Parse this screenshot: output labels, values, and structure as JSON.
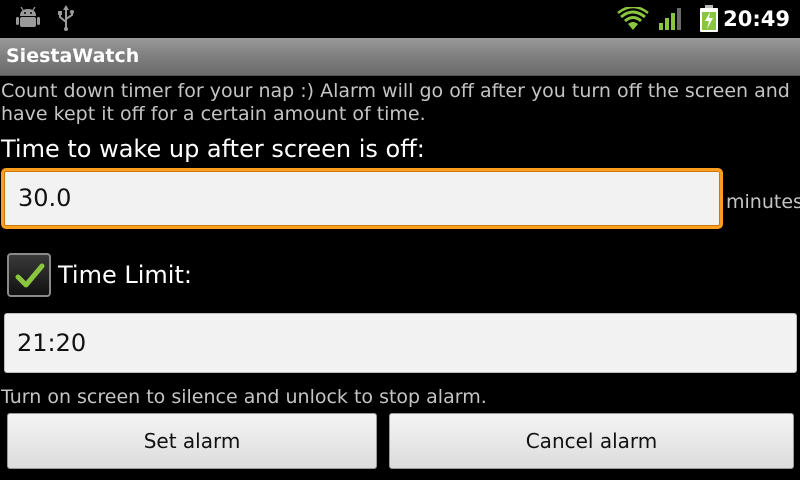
{
  "status_bar": {
    "time": "20:49",
    "icons": [
      "android-debug-icon",
      "usb-icon",
      "wifi-icon",
      "signal-icon",
      "battery-charging-icon"
    ],
    "accent_color": "#8ac53f"
  },
  "app": {
    "title": "SiestaWatch"
  },
  "main": {
    "description": "Count down timer for your nap :) Alarm will go off after you turn off the screen and have kept it off for a certain amount of time.",
    "wake_label": "Time to wake up after screen is off:",
    "minutes_value": "30.0",
    "minutes_unit": "minutes",
    "time_limit_checked": true,
    "time_limit_label": "Time Limit:",
    "time_limit_value": "21:20",
    "hint": "Turn on screen to silence and unlock to stop alarm.",
    "focus_color": "#ff9d1c"
  },
  "buttons": {
    "set_alarm": "Set alarm",
    "cancel_alarm": "Cancel alarm"
  }
}
